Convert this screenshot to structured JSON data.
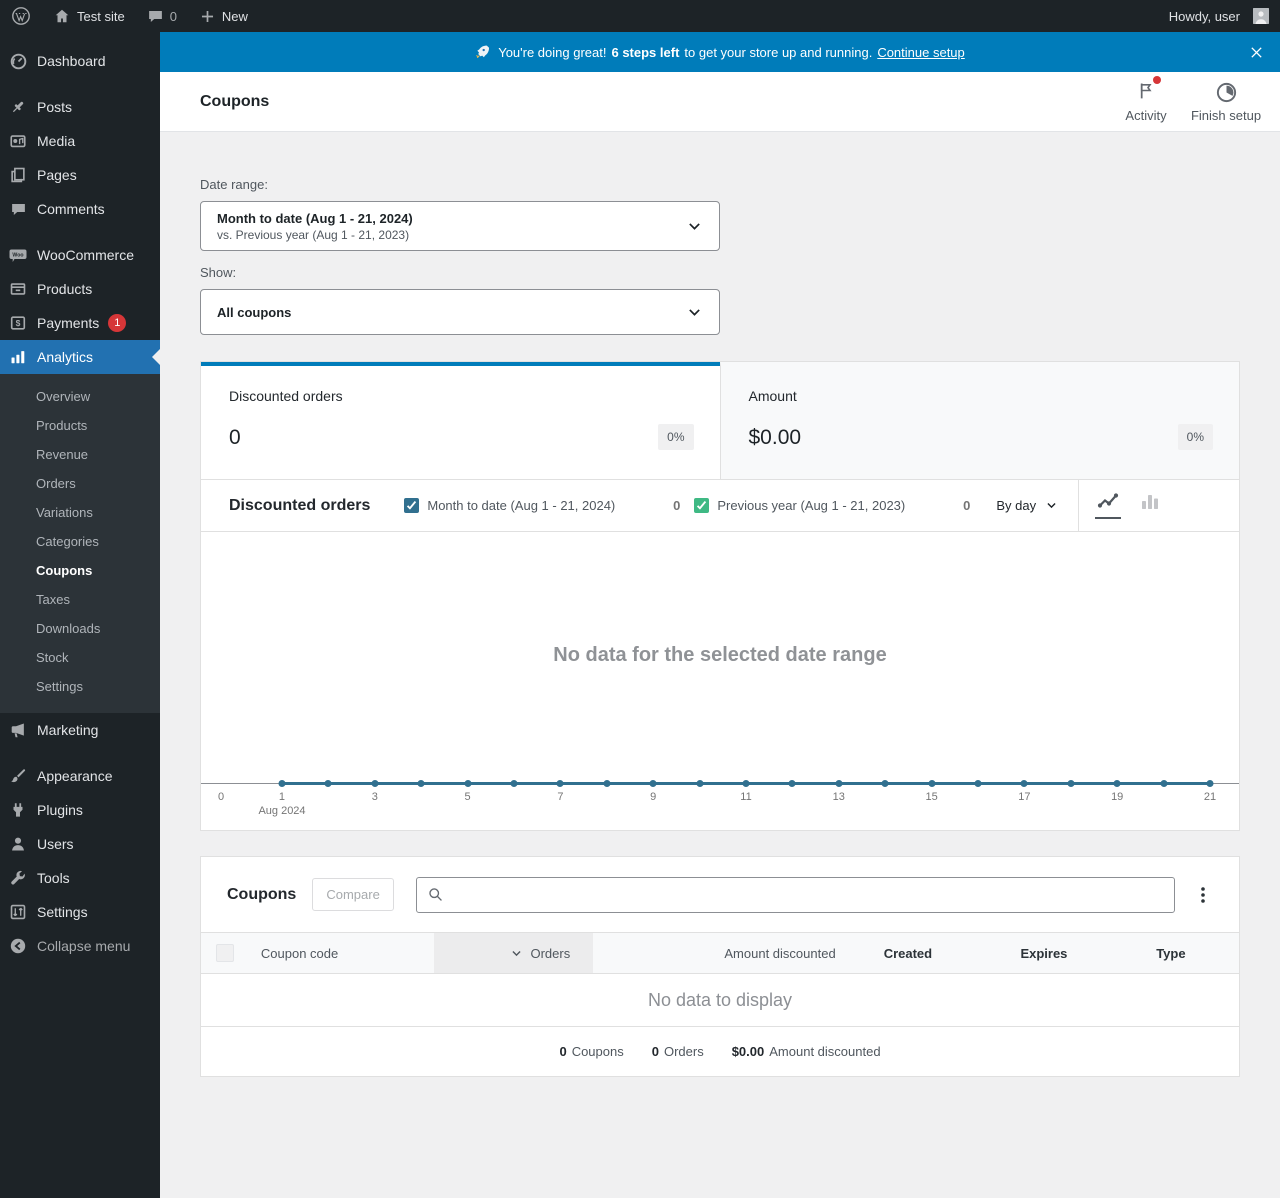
{
  "admin_bar": {
    "site_name": "Test site",
    "comments_count": "0",
    "new_label": "New",
    "howdy_text": "Howdy, user"
  },
  "sidebar": {
    "groups": [
      {
        "items": [
          {
            "id": "dashboard",
            "label": "Dashboard",
            "icon": "dashboard-icon"
          }
        ]
      },
      {
        "items": [
          {
            "id": "posts",
            "label": "Posts",
            "icon": "pin-icon"
          },
          {
            "id": "media",
            "label": "Media",
            "icon": "media-icon"
          },
          {
            "id": "pages",
            "label": "Pages",
            "icon": "pages-icon"
          },
          {
            "id": "comments",
            "label": "Comments",
            "icon": "comment-icon"
          }
        ]
      },
      {
        "items": [
          {
            "id": "woocommerce",
            "label": "WooCommerce",
            "icon": "woocommerce-icon"
          },
          {
            "id": "products",
            "label": "Products",
            "icon": "products-icon"
          },
          {
            "id": "payments",
            "label": "Payments",
            "icon": "payments-icon",
            "badge": "1"
          },
          {
            "id": "analytics",
            "label": "Analytics",
            "icon": "analytics-icon",
            "active": true,
            "submenu": [
              "Overview",
              "Products",
              "Revenue",
              "Orders",
              "Variations",
              "Categories",
              "Coupons",
              "Taxes",
              "Downloads",
              "Stock",
              "Settings"
            ],
            "submenu_active": "Coupons"
          },
          {
            "id": "marketing",
            "label": "Marketing",
            "icon": "megaphone-icon"
          }
        ]
      },
      {
        "items": [
          {
            "id": "appearance",
            "label": "Appearance",
            "icon": "brush-icon"
          },
          {
            "id": "plugins",
            "label": "Plugins",
            "icon": "plugin-icon"
          },
          {
            "id": "users",
            "label": "Users",
            "icon": "user-icon"
          },
          {
            "id": "tools",
            "label": "Tools",
            "icon": "wrench-icon"
          },
          {
            "id": "settings",
            "label": "Settings",
            "icon": "sliders-icon"
          }
        ]
      },
      {
        "items": [
          {
            "id": "collapse-menu",
            "label": "Collapse menu",
            "icon": "collapse-icon",
            "dim": true
          }
        ]
      }
    ]
  },
  "banner": {
    "text_1": "You're doing great!",
    "text_bold": "6 steps left",
    "text_2": "to get your store up and running.",
    "link_label": "Continue setup"
  },
  "page_header": {
    "title": "Coupons",
    "activity_label": "Activity",
    "finish_setup_label": "Finish setup"
  },
  "filters": {
    "date_range_label": "Date range:",
    "date_range_value": "Month to date (Aug 1 - 21, 2024)",
    "date_range_compare": "vs. Previous year (Aug 1 - 21, 2023)",
    "show_label": "Show:",
    "show_value": "All coupons"
  },
  "summary_tiles": [
    {
      "label": "Discounted orders",
      "value": "0",
      "delta": "0%",
      "selected": true
    },
    {
      "label": "Amount",
      "value": "$0.00",
      "delta": "0%",
      "selected": false
    }
  ],
  "chart_section": {
    "title": "Discounted orders",
    "legend": [
      {
        "label": "Month to date (Aug 1 - 21, 2024)",
        "count": "0",
        "color": "#31708f",
        "checked": true
      },
      {
        "label": "Previous year (Aug 1 - 21, 2023)",
        "count": "0",
        "color": "#3fb984",
        "checked": true
      }
    ],
    "interval_label": "By day",
    "empty_message": "No data for the selected date range"
  },
  "chart_data": {
    "type": "line",
    "title": "Discounted orders",
    "x_ticks": [
      "0",
      "1",
      "3",
      "5",
      "7",
      "9",
      "11",
      "13",
      "15",
      "17",
      "19",
      "21"
    ],
    "x_month_label": "Aug 2024",
    "x_month_under_tick": "1",
    "xlabel": "",
    "ylabel": "",
    "ylim": [
      0,
      1
    ],
    "grid": false,
    "series": [
      {
        "name": "Month to date (Aug 1 - 21, 2024)",
        "x_days": [
          1,
          2,
          3,
          4,
          5,
          6,
          7,
          8,
          9,
          10,
          11,
          12,
          13,
          14,
          15,
          16,
          17,
          18,
          19,
          20,
          21
        ],
        "values": [
          0,
          0,
          0,
          0,
          0,
          0,
          0,
          0,
          0,
          0,
          0,
          0,
          0,
          0,
          0,
          0,
          0,
          0,
          0,
          0,
          0
        ]
      },
      {
        "name": "Previous year (Aug 1 - 21, 2023)",
        "x_days": [
          1,
          2,
          3,
          4,
          5,
          6,
          7,
          8,
          9,
          10,
          11,
          12,
          13,
          14,
          15,
          16,
          17,
          18,
          19,
          20,
          21
        ],
        "values": [
          0,
          0,
          0,
          0,
          0,
          0,
          0,
          0,
          0,
          0,
          0,
          0,
          0,
          0,
          0,
          0,
          0,
          0,
          0,
          0,
          0
        ]
      }
    ]
  },
  "table": {
    "title": "Coupons",
    "compare_label": "Compare",
    "search_placeholder": "",
    "search_value": "",
    "columns": [
      {
        "label": "Coupon code",
        "sortable": true
      },
      {
        "label": "Orders",
        "sortable": true,
        "sorted": "desc"
      },
      {
        "label": "Amount discounted",
        "sortable": true
      },
      {
        "label": "Created"
      },
      {
        "label": "Expires"
      },
      {
        "label": "Type"
      }
    ],
    "empty_message": "No data to display",
    "summary": [
      {
        "value": "0",
        "label": "Coupons"
      },
      {
        "value": "0",
        "label": "Orders"
      },
      {
        "value": "$0.00",
        "label": "Amount discounted"
      }
    ]
  },
  "colors": {
    "banner_blue": "#007cba",
    "menu_active_blue": "#2271b1",
    "series_current": "#31708f",
    "series_previous": "#3fb984",
    "badge_red": "#d63638"
  }
}
